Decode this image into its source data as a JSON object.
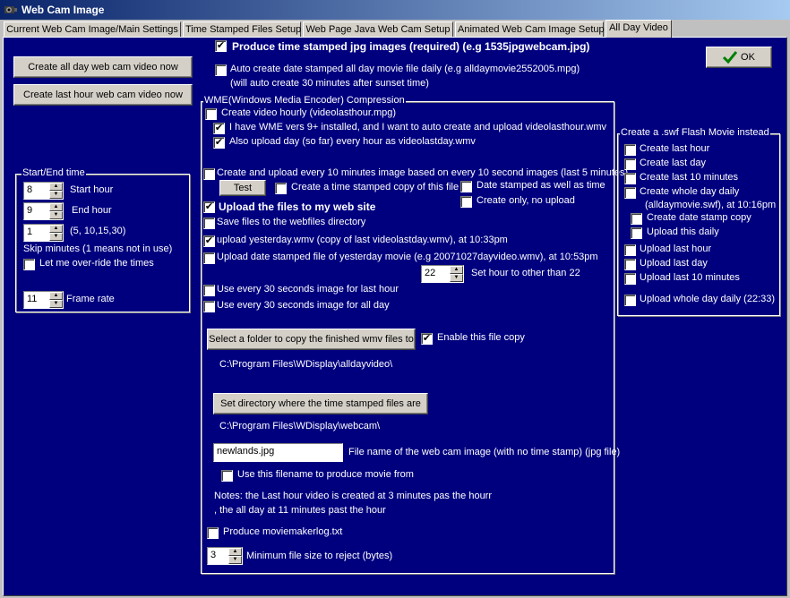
{
  "window": {
    "title": "Web Cam Image"
  },
  "tabs": [
    "Current Web Cam Image/Main Settings",
    "Time Stamped Files Setup",
    "Web Page Java Web Cam Setup",
    "Animated Web Cam Image Setup",
    "All Day Video"
  ],
  "top": {
    "produce_jpg": "Produce time stamped jpg images (required) (e.g 1535jpgwebcam.jpg)",
    "auto_create": "Auto create date stamped all day movie file daily (e.g alldaymovie2552005.mpg)",
    "auto_create_note": "(will auto create 30 minutes after sunset time)",
    "ok_label": "OK"
  },
  "left_buttons": {
    "all_day": "Create all day web cam video now",
    "last_hour": "Create last hour web cam video now"
  },
  "start_end": {
    "group_title": "Start/End time",
    "start_value": "8",
    "start_label": "Start hour",
    "end_value": "9",
    "end_label": "End hour",
    "skip_value": "1",
    "skip_hint": "(5, 10,15,30)",
    "skip_label": "Skip minutes (1 means not in use)",
    "override_label": "Let me over-ride the times",
    "frame_value": "11",
    "frame_label": "Frame rate"
  },
  "wme": {
    "group_title": "WME(Windows Media Encoder) Compression",
    "create_hourly": "Create video hourly (videolasthour.mpg)",
    "have_wme": "I have WME vers 9+ installed, and I want to auto create and upload videolasthour.wmv",
    "also_upload": "Also upload day (so far) every hour as videolastday.wmv",
    "every10": "Create and upload every 10 minutes image based on every 10 second images (last 5 minutes)",
    "test_label": "Test",
    "ts_copy": "Create a time stamped copy of this file",
    "date_stamped": "Date stamped as well as time",
    "create_only": "Create only, no upload",
    "upload_files": "Upload the files to my web site",
    "save_webfiles": "Save files to the webfiles directory",
    "upload_yesterday": "upload yesterday.wmv (copy of last videolastday.wmv), at 10:33pm",
    "upload_date_stamped": "Upload date stamped file of yesterday movie (e.g 20071027dayvideo.wmv), at 10:53pm",
    "hour_value": "22",
    "hour_label": "Set hour to other than 22",
    "every30_hour": "Use every 30 seconds image for last hour",
    "every30_day": "Use every 30 seconds image for all day",
    "folder_button": "Select a folder to copy the finished wmv files to",
    "enable_copy": "Enable this file copy",
    "folder_path": "C:\\Program Files\\WDisplay\\alldayvideo\\",
    "dir_button": "Set directory where the time stamped files are",
    "dir_path": "C:\\Program Files\\WDisplay\\webcam\\",
    "filename_value": "newlands.jpg",
    "filename_label": "File name of the web cam image (with no time stamp) (jpg file)",
    "use_filename": "Use this filename to produce movie from",
    "notes1": "Notes: the Last hour video is created at 3 minutes pas the hourr",
    "notes2": ", the all day at 11 minutes past the hour",
    "moviemaker": "Produce moviemakerlog.txt",
    "minsize_value": "3",
    "minsize_label": "Minimum file size to reject (bytes)"
  },
  "swf": {
    "group_title": "Create a .swf Flash Movie instead",
    "last_hour": "Create last hour",
    "last_day": "Create last day",
    "last_10": "Create last 10 minutes",
    "whole_day": "Create whole day daily",
    "whole_day_note": "(alldaymovie.swf), at 10:16pm",
    "date_copy": "Create date stamp copy",
    "upload_daily": "Upload this daily",
    "up_last_hour": "Upload last hour",
    "up_last_day": "Upload last day",
    "up_last_10": "Upload last 10 minutes",
    "up_whole_day": "Upload whole day daily (22:33)"
  }
}
